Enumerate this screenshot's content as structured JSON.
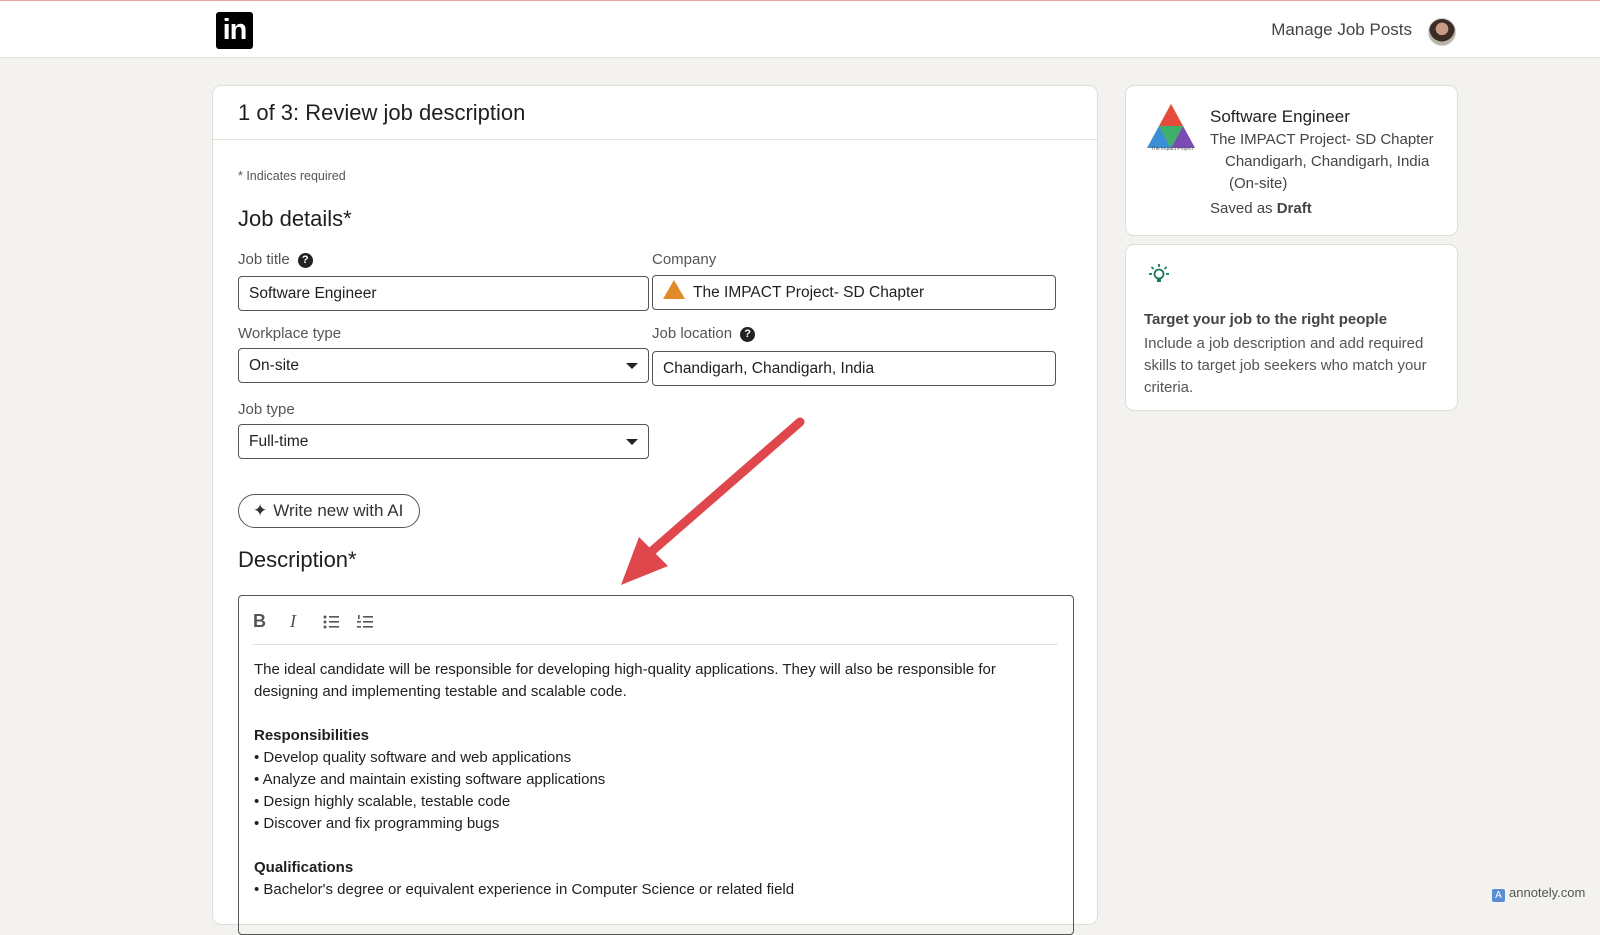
{
  "header": {
    "logo_text": "in",
    "manage_label": "Manage Job Posts"
  },
  "main": {
    "step_title": "1 of 3: Review job description",
    "required_note": "* Indicates required",
    "job_details_heading": "Job details*",
    "job_title": {
      "label": "Job title",
      "value": "Software Engineer"
    },
    "company": {
      "label": "Company",
      "value": "The IMPACT Project- SD Chapter"
    },
    "workplace_type": {
      "label": "Workplace type",
      "value": "On-site"
    },
    "job_location": {
      "label": "Job location",
      "value": "Chandigarh, Chandigarh, India"
    },
    "job_type": {
      "label": "Job type",
      "value": "Full-time"
    },
    "ai_button_label": "Write new with AI",
    "description_heading": "Description*",
    "toolbar": {
      "bold": "B",
      "italic": "I"
    },
    "description": {
      "intro_1": "The ideal candidate will be responsible for developing high-quality applications. They will also be responsible for",
      "intro_2": "designing and implementing testable and scalable code.",
      "responsibilities_heading": "Responsibilities",
      "responsibilities": [
        "• Develop quality software and web applications",
        "• Analyze and maintain existing software applications",
        "• Design highly scalable, testable code",
        "• Discover and fix programming bugs"
      ],
      "qualifications_heading": "Qualifications",
      "qualifications": [
        "• Bachelor's degree or equivalent experience in Computer Science or related field"
      ]
    }
  },
  "sidebar": {
    "job_title": "Software Engineer",
    "company": "The IMPACT Project- SD Chapter",
    "location": "Chandigarh, Chandigarh, India",
    "workplace": "(On-site)",
    "saved_prefix": "Saved as",
    "saved_status": "Draft",
    "logo_caption": "The Impact Project",
    "tip_heading": "Target your job to the right people",
    "tip_body": "Include a job description and add required skills to target job seekers who match your criteria."
  },
  "watermark": {
    "icon": "A",
    "text": "annotely.com"
  },
  "colors": {
    "annotation_arrow": "#e0474c",
    "tip_icon": "#1a7a5e"
  }
}
